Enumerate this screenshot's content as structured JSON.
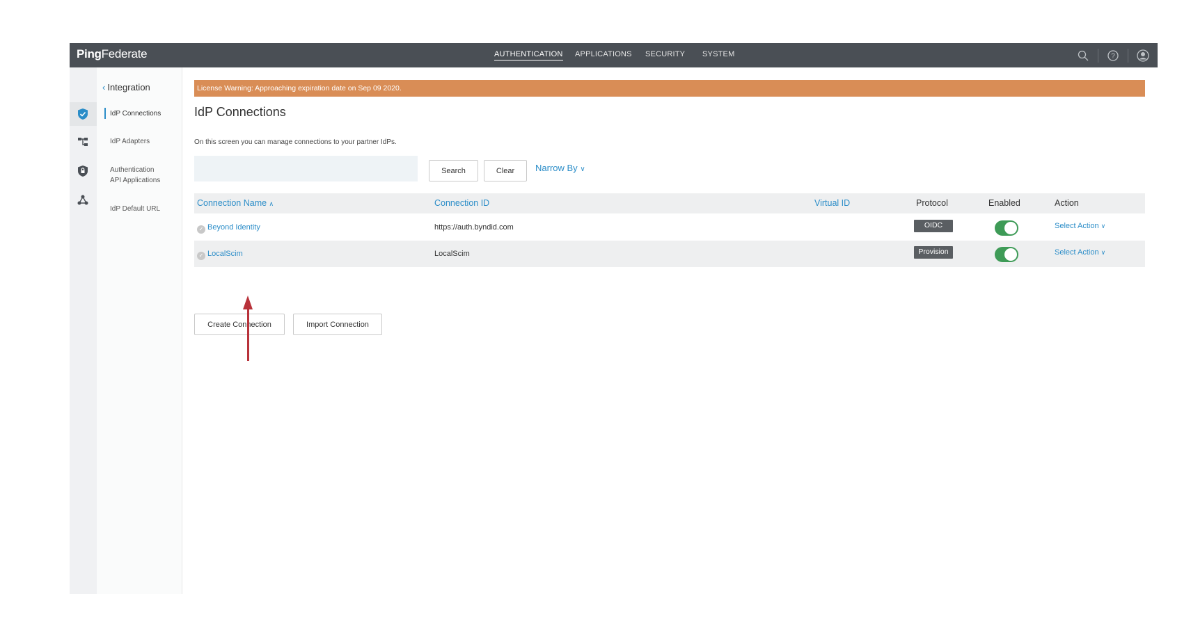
{
  "app": {
    "logo_bold": "Ping",
    "logo_rest": "Federate"
  },
  "topnav": {
    "items": [
      "AUTHENTICATION",
      "APPLICATIONS",
      "SECURITY",
      "SYSTEM"
    ],
    "active": "AUTHENTICATION",
    "icons": [
      "search-icon",
      "help-icon",
      "user-icon"
    ]
  },
  "rail": {
    "icons": [
      "shield-check-icon",
      "hierarchy-icon",
      "shield-lock-icon",
      "network-icon"
    ]
  },
  "subnav": {
    "back_label": "Integration",
    "items": [
      {
        "line1": "IdP Connections",
        "line2": "",
        "active": true
      },
      {
        "line1": "IdP Adapters",
        "line2": "",
        "active": false
      },
      {
        "line1": "Authentication",
        "line2": "API Applications",
        "active": false
      },
      {
        "line1": "IdP Default URL",
        "line2": "",
        "active": false
      }
    ]
  },
  "banner": "License Warning: Approaching expiration date on Sep 09 2020.",
  "page": {
    "title": "IdP Connections",
    "description": "On this screen you can manage connections to your partner IdPs."
  },
  "search": {
    "value": "",
    "placeholder": "",
    "search_label": "Search",
    "clear_label": "Clear",
    "narrow_label": "Narrow By"
  },
  "table": {
    "columns": [
      "Connection Name",
      "Connection ID",
      "Virtual ID",
      "Protocol",
      "Enabled",
      "Action"
    ],
    "rows": [
      {
        "name": "Beyond Identity",
        "connection_id": "https://auth.byndid.com",
        "virtual_id": "",
        "protocol": "OIDC",
        "enabled": true,
        "action": "Select Action"
      },
      {
        "name": "LocalScim",
        "connection_id": "LocalScim",
        "virtual_id": "",
        "protocol": "Provision",
        "enabled": true,
        "action": "Select Action"
      }
    ]
  },
  "buttons": {
    "create": "Create Connection",
    "import": "Import Connection"
  },
  "colors": {
    "topbar": "#4a4f55",
    "banner": "#d98d56",
    "link": "#2b8dc8",
    "toggle_on": "#3e9b57",
    "arrow": "#b8323a"
  }
}
